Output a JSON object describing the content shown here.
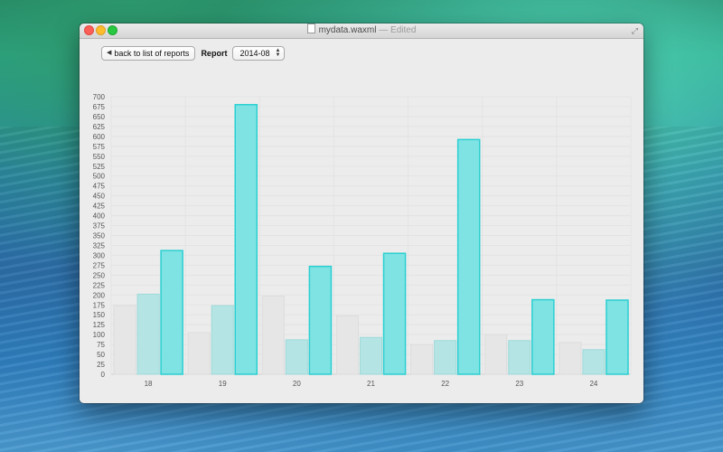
{
  "window": {
    "title": "mydata.waxml",
    "title_suffix": "— Edited"
  },
  "toolbar": {
    "back_label": "back to list of reports",
    "report_label": "Report",
    "report_value": "2014-08"
  },
  "icons": {
    "back": "triangle-left-icon",
    "document": "document-icon",
    "fullscreen": "fullscreen-icon",
    "select": "updown-chevron-icon"
  },
  "colors": {
    "bar_1": "#e6e6e6",
    "bar_2": "#b5e4e4",
    "bar_3": "#7fe3e3",
    "bar_3_stroke": "#2bcfd2"
  },
  "chart_data": {
    "type": "bar",
    "categories": [
      "18",
      "19",
      "20",
      "21",
      "22",
      "23",
      "24"
    ],
    "series": [
      {
        "values": [
          173,
          105,
          197,
          147,
          75,
          100,
          80
        ]
      },
      {
        "values": [
          202,
          173,
          87,
          93,
          85,
          85,
          62
        ]
      },
      {
        "values": [
          312,
          680,
          272,
          305,
          592,
          188,
          187
        ]
      }
    ],
    "ylim": [
      0,
      700
    ],
    "ytick_step": 25,
    "grid": true,
    "legend": "none"
  }
}
